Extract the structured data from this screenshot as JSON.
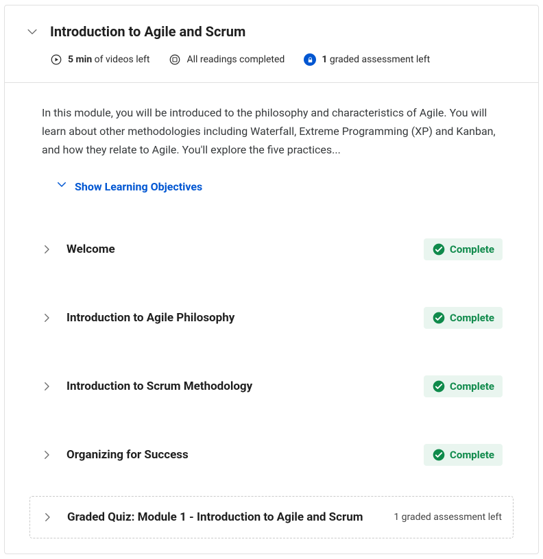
{
  "module": {
    "title": "Introduction to Agile and Scrum",
    "stats": {
      "videos_bold": "5 min",
      "videos_rest": " of videos left",
      "readings": "All readings completed",
      "assessments_bold": "1",
      "assessments_rest": " graded assessment left"
    },
    "description": "In this module, you will be introduced to the philosophy and characteristics of Agile. You will learn about other methodologies including Waterfall, Extreme Programming (XP) and Kanban, and how they relate to Agile. You'll explore the five practices...",
    "show_objectives_label": "Show Learning Objectives",
    "sections": [
      {
        "title": "Welcome",
        "status": "Complete"
      },
      {
        "title": "Introduction to Agile Philosophy",
        "status": "Complete"
      },
      {
        "title": "Introduction to Scrum Methodology",
        "status": "Complete"
      },
      {
        "title": "Organizing for Success",
        "status": "Complete"
      }
    ],
    "quiz": {
      "title": "Graded Quiz: Module 1 - Introduction to Agile and Scrum",
      "status": "1 graded assessment left"
    }
  }
}
